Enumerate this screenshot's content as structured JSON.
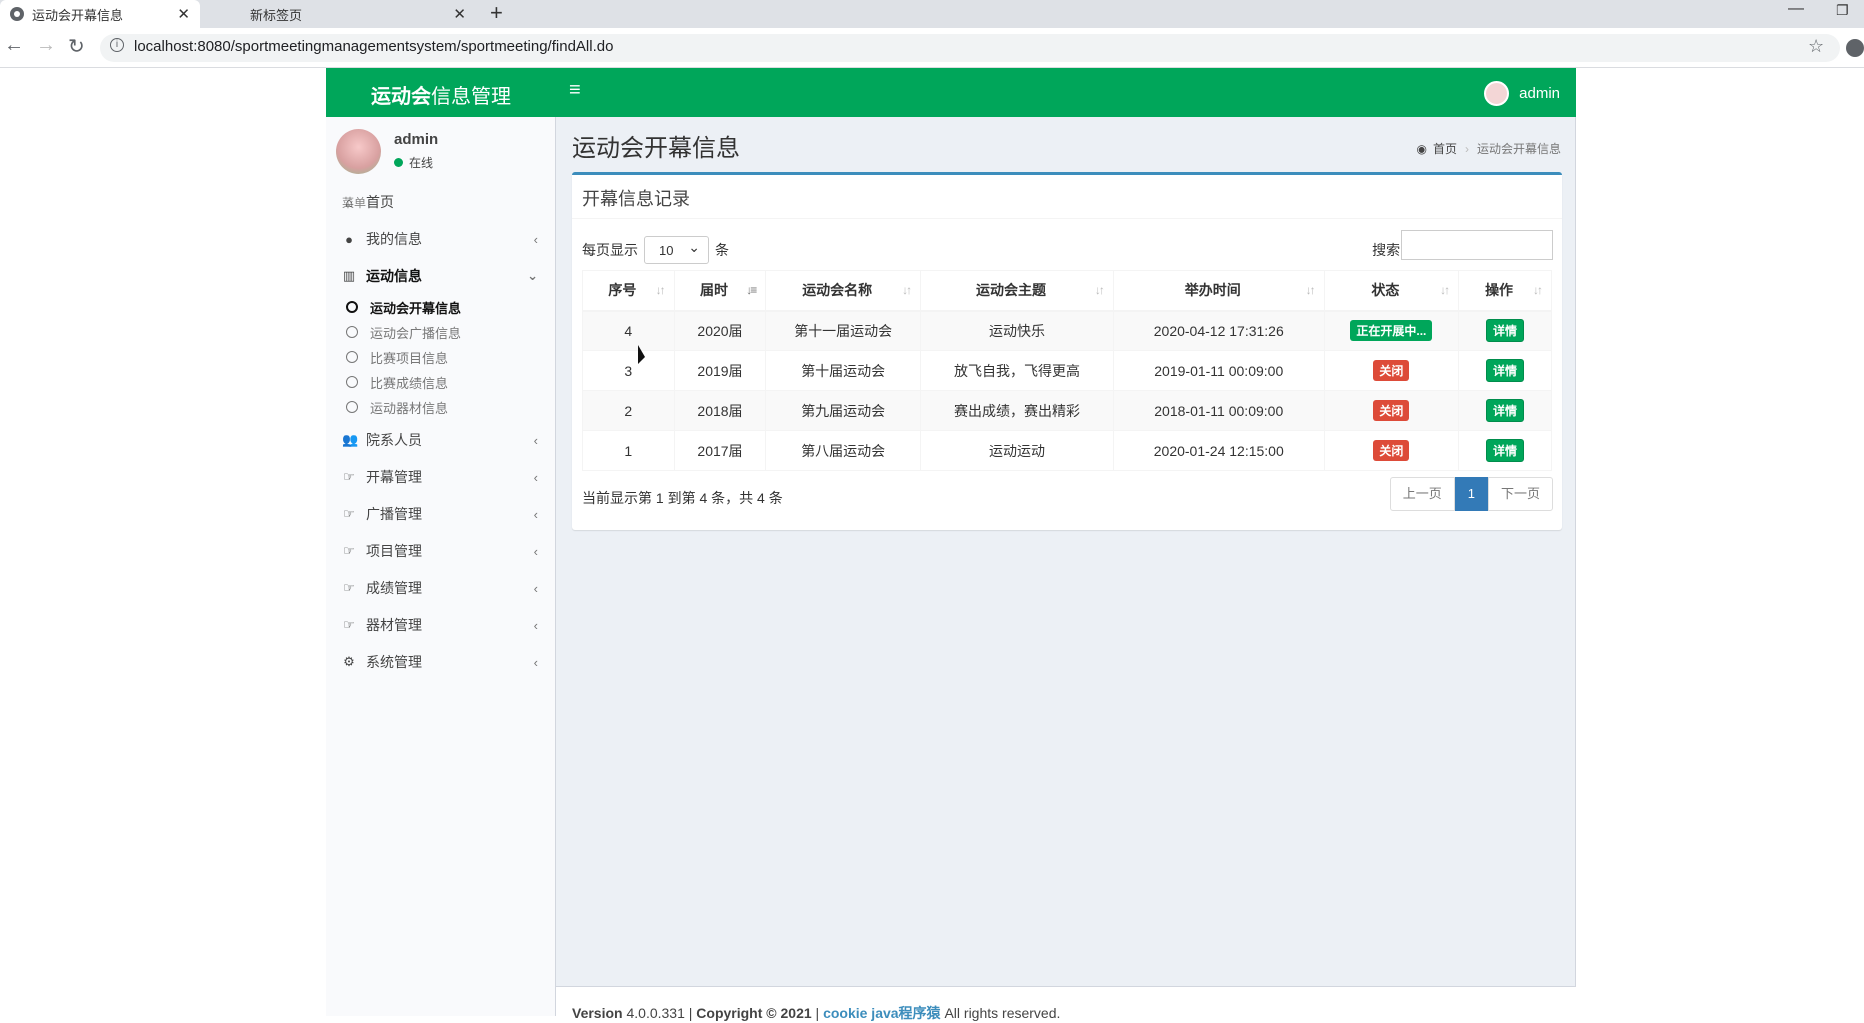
{
  "browser": {
    "tabs": [
      {
        "label": "运动会开幕信息",
        "close": "✕"
      },
      {
        "label": "新标签页",
        "close": "✕"
      }
    ],
    "new_tab": "+",
    "url": "localhost:8080/sportmeetingmanagementsystem/sportmeeting/findAll.do"
  },
  "header": {
    "logo_bold": "运动会",
    "logo_rest": "信息管理",
    "user": "admin"
  },
  "sidebar": {
    "user_name": "admin",
    "status": "在线",
    "menu_header": "菜单",
    "items": [
      {
        "label": "首页",
        "icon": "home-icon"
      },
      {
        "label": "我的信息",
        "icon": "user-icon"
      },
      {
        "label": "运动信息",
        "icon": "chart-icon"
      },
      {
        "label": "院系人员",
        "icon": "users-icon"
      },
      {
        "label": "开幕管理",
        "icon": "share-icon"
      },
      {
        "label": "广播管理",
        "icon": "share-icon"
      },
      {
        "label": "项目管理",
        "icon": "share-icon"
      },
      {
        "label": "成绩管理",
        "icon": "share-icon"
      },
      {
        "label": "器材管理",
        "icon": "share-icon"
      },
      {
        "label": "系统管理",
        "icon": "gear-icon"
      }
    ],
    "sub_items": [
      {
        "label": "运动会开幕信息"
      },
      {
        "label": "运动会广播信息"
      },
      {
        "label": "比赛项目信息"
      },
      {
        "label": "比赛成绩信息"
      },
      {
        "label": "运动器材信息"
      }
    ]
  },
  "page": {
    "title": "运动会开幕信息",
    "breadcrumb_home": "首页",
    "breadcrumb_current": "运动会开幕信息"
  },
  "box": {
    "title": "开幕信息记录",
    "per_page_label": "每页显示",
    "per_page_value": "10",
    "per_page_unit": "条",
    "search_label": "搜索:",
    "columns": [
      "序号",
      "届时",
      "运动会名称",
      "运动会主题",
      "举办时间",
      "状态",
      "操作"
    ],
    "rows": [
      {
        "id": "4",
        "session": "2020届",
        "name": "第十一届运动会",
        "theme": "运动快乐",
        "time": "2020-04-12 17:31:26",
        "status": "正在开展中...",
        "status_type": "green",
        "action": "详情"
      },
      {
        "id": "3",
        "session": "2019届",
        "name": "第十届运动会",
        "theme": "放飞自我，飞得更高",
        "time": "2019-01-11 00:09:00",
        "status": "关闭",
        "status_type": "red",
        "action": "详情"
      },
      {
        "id": "2",
        "session": "2018届",
        "name": "第九届运动会",
        "theme": "赛出成绩，赛出精彩",
        "time": "2018-01-11 00:09:00",
        "status": "关闭",
        "status_type": "red",
        "action": "详情"
      },
      {
        "id": "1",
        "session": "2017届",
        "name": "第八届运动会",
        "theme": "运动运动",
        "time": "2020-01-24 12:15:00",
        "status": "关闭",
        "status_type": "red",
        "action": "详情"
      }
    ],
    "info": "当前显示第 1 到第 4 条，共 4 条",
    "pager": {
      "prev": "上一页",
      "current": "1",
      "next": "下一页"
    }
  },
  "footer": {
    "version_label": "Version",
    "version": "4.0.0.331",
    "copyright": "Copyright © 2021",
    "link": "cookie java程序猿",
    "rights": "All rights reserved."
  },
  "colors": {
    "header": "#00a65a",
    "box_top": "#3c8dbc",
    "status_red": "#dd4b39",
    "pager_active": "#337ab7"
  }
}
